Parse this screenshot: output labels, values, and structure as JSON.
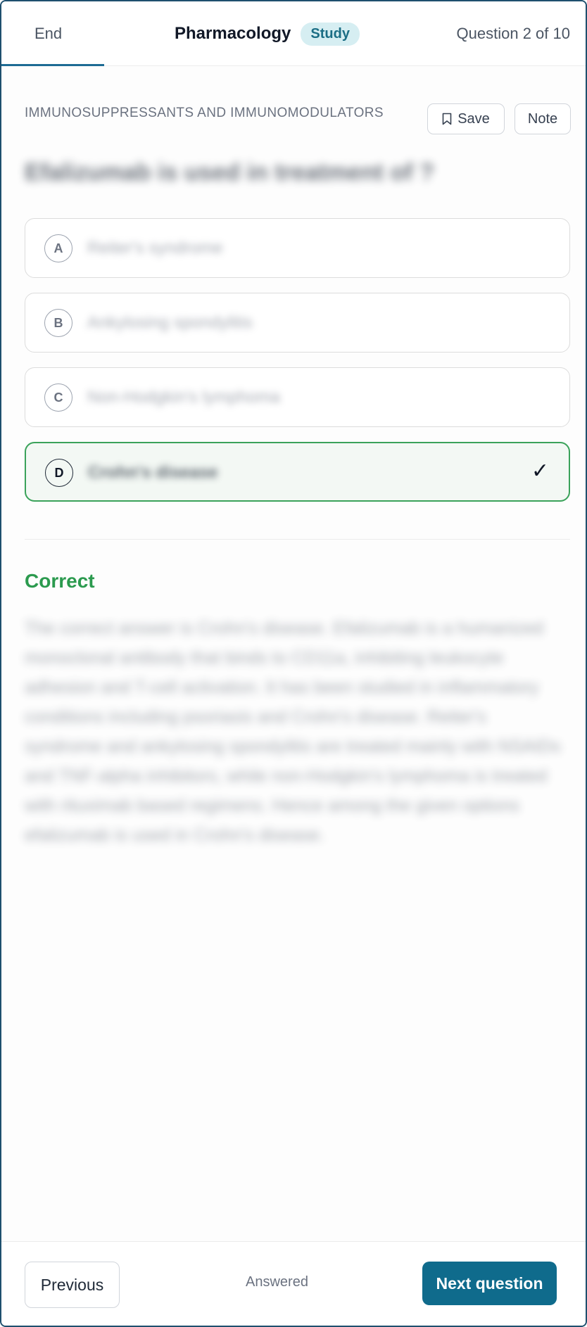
{
  "header": {
    "end_label": "End",
    "title": "Pharmacology",
    "mode_badge": "Study",
    "counter": "Question 2 of 10",
    "progress_fraction": 0.2
  },
  "topic": "IMMUNOSUPPRESSANTS AND IMMUNOMODULATORS",
  "tools": {
    "save_label": "Save",
    "note_label": "Note"
  },
  "question": {
    "text": "Efalizumab is used in treatment of ?"
  },
  "options": [
    {
      "letter": "A",
      "text": "Reiter's syndrome"
    },
    {
      "letter": "B",
      "text": "Ankylosing spondylitis"
    },
    {
      "letter": "C",
      "text": "Non-Hodgkin's lymphoma"
    },
    {
      "letter": "D",
      "text": "Crohn's disease",
      "selected": true,
      "correct": true
    }
  ],
  "result": {
    "label": "Correct",
    "color": "#2b9a4e",
    "explanation": "The correct answer is Crohn's disease. Efalizumab is a humanized monoclonal antibody that binds to CD11a, inhibiting leukocyte adhesion and T-cell activation. It has been studied in inflammatory conditions including psoriasis and Crohn's disease. Reiter's syndrome and ankylosing spondylitis are treated mainly with NSAIDs and TNF-alpha inhibitors, while non-Hodgkin's lymphoma is treated with rituximab based regimens. Hence among the given options efalizumab is used in Crohn's disease."
  },
  "footer": {
    "previous_label": "Previous",
    "status": "Answered",
    "next_label": "Next question"
  },
  "colors": {
    "accent": "#0f6b8c",
    "correct_border": "#3aa25a",
    "badge_bg": "#d6eef2"
  }
}
